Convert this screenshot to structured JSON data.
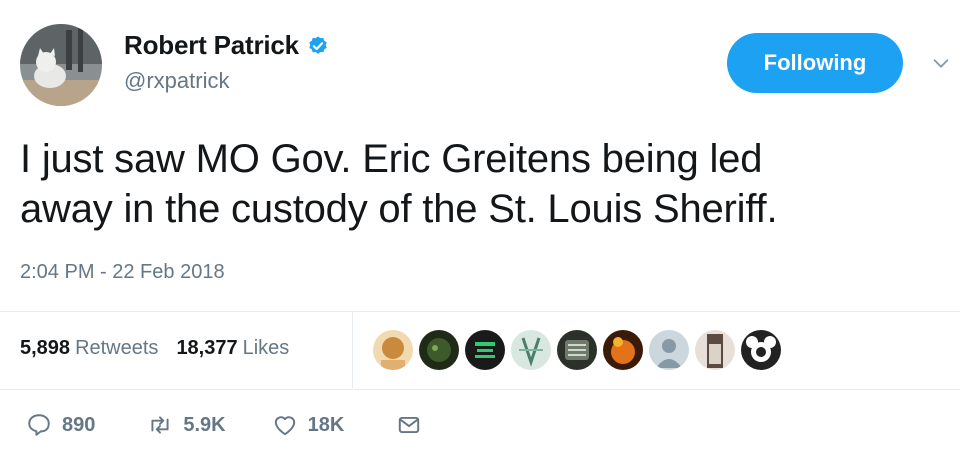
{
  "user": {
    "name": "Robert Patrick",
    "handle": "@rxpatrick",
    "verified": true,
    "follow_label": "Following"
  },
  "tweet": {
    "text_line1": "I just saw MO Gov. Eric Greitens being led",
    "text_line2": "away in the custody of the St. Louis Sheriff.",
    "timestamp": "2:04 PM - 22 Feb 2018"
  },
  "stats": {
    "retweets_count": "5,898",
    "retweets_label": "Retweets",
    "likes_count": "18,377",
    "likes_label": "Likes"
  },
  "likers": [
    {
      "icon": "liker-avatar-1",
      "color": "#c98a3e"
    },
    {
      "icon": "liker-avatar-2",
      "color": "#3d5a2a"
    },
    {
      "icon": "liker-avatar-3",
      "color": "#1a1a1a"
    },
    {
      "icon": "liker-avatar-4",
      "color": "#7fb3a0"
    },
    {
      "icon": "liker-avatar-5",
      "color": "#4e5a4a"
    },
    {
      "icon": "liker-avatar-6",
      "color": "#e2731a"
    },
    {
      "icon": "liker-avatar-7",
      "color": "#b8c4cf"
    },
    {
      "icon": "liker-avatar-8",
      "color": "#5a4a3f"
    },
    {
      "icon": "liker-avatar-9",
      "color": "#222222"
    }
  ],
  "actions": {
    "replies": "890",
    "retweets": "5.9K",
    "likes": "18K"
  },
  "colors": {
    "accent": "#1da1f2",
    "text": "#14171a",
    "secondary": "#657786",
    "divider": "#e6ecf0"
  }
}
